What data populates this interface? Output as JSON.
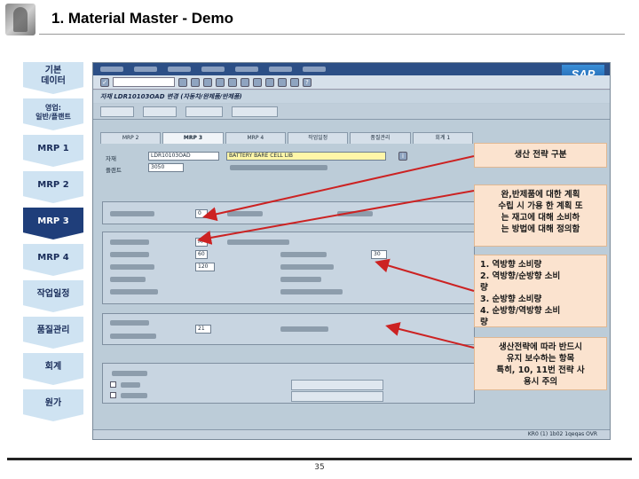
{
  "slide": {
    "title": "1. Material Master - Demo",
    "page_number": "35"
  },
  "nav": [
    {
      "label": "기본\n데이터",
      "active": false
    },
    {
      "label": "영업:\n일반/플랜트",
      "active": false
    },
    {
      "label": "MRP 1",
      "active": false
    },
    {
      "label": "MRP 2",
      "active": false
    },
    {
      "label": "MRP 3",
      "active": true
    },
    {
      "label": "MRP 4",
      "active": false
    },
    {
      "label": "작업일정",
      "active": false
    },
    {
      "label": "품질관리",
      "active": false
    },
    {
      "label": "회계",
      "active": false
    },
    {
      "label": "원가",
      "active": false
    }
  ],
  "sap": {
    "logo": "SAP",
    "title_bar": "자재 LDR10103OAD 변경 (자동차/완제품/반제품)",
    "tabs": [
      "MRP 2",
      "MRP 3",
      "MRP 4",
      "작업일정",
      "품질관리",
      "회계 1"
    ],
    "fields": {
      "material_label": "자재",
      "material_value": "LDR10103OAD",
      "material_desc": "BATTERY BARE CELL LIB",
      "plant_label": "플랜트",
      "plant_value": "3050",
      "horizon_value": "0",
      "period_value": "M",
      "strategy_value": "60",
      "avail_value": "120",
      "consumption_value": "30",
      "receipt_value": "21"
    },
    "status": "KR0 (1) 1b02  1qeqas  OVR"
  },
  "callouts": {
    "strategy_group": "생산 전략 구분",
    "strategy_desc": "완,반제품에 대한 계획\n수립 시 가용 한 계획 또\n는 재고에 대해 소비하\n는 방법에 대해 정의함",
    "consumption_modes": "1. 역방향 소비량\n2. 역방향/순방향 소비\n량\n3. 순방향 소비량\n4. 순방향/역방향 소비\n량",
    "note": "생산전략에 따라 반드시\n유지 보수하는 항목\n특히, 10, 11번 전략 사\n용시 주의"
  },
  "colors": {
    "nav_active": "#1f3e7a",
    "nav_inactive": "#cfe3f2",
    "callout_fill": "#fbe3cf",
    "sap_menubar": "#2c4f86",
    "highlight_field": "#fff6a8"
  }
}
